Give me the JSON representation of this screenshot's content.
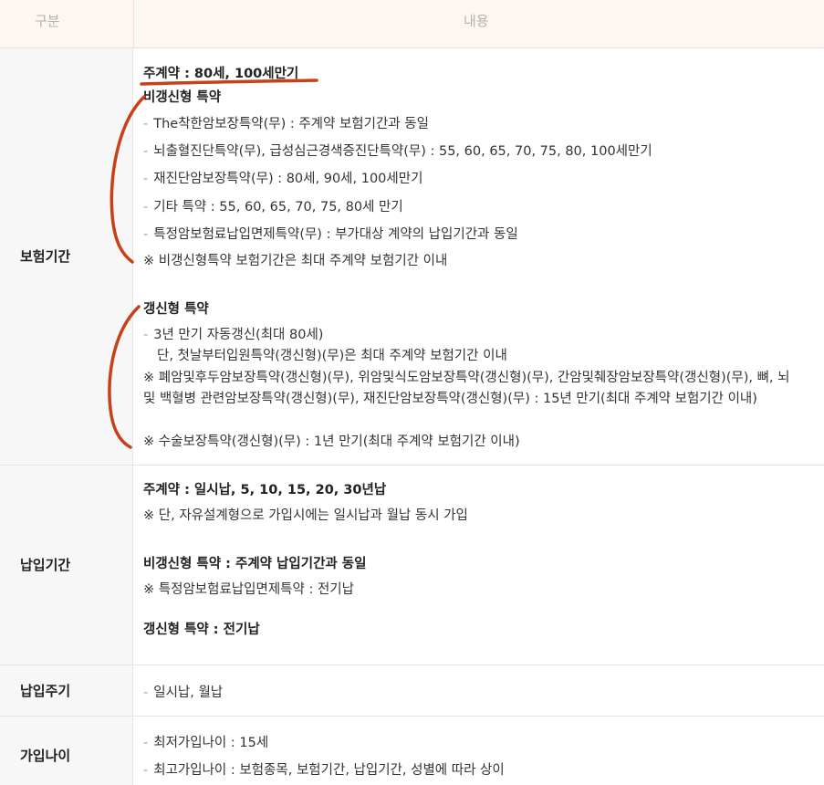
{
  "header": {
    "col1": "구분",
    "col2": "내용"
  },
  "rows": {
    "period": {
      "label": "보험기간",
      "main": "주계약 : 80세, 100세만기",
      "nonrenew_title": "비갱신형 특약",
      "nonrenew_items": [
        "The착한암보장특약(무) : 주계약 보험기간과 동일",
        "뇌출혈진단특약(무), 급성심근경색증진단특약(무) : 55, 60, 65, 70, 75, 80, 100세만기",
        "재진단암보장특약(무) : 80세, 90세, 100세만기",
        "기타 특약 : 55, 60, 65, 70, 75, 80세 만기",
        "특정암보험료납입면제특약(무) : 부가대상 계약의 납입기간과 동일"
      ],
      "nonrenew_note": "※ 비갱신형특약 보험기간은 최대 주계약 보험기간 이내",
      "renew_title": "갱신형 특약",
      "renew_item1": "3년 만기 자동갱신(최대 80세)",
      "renew_item1_sub": "단, 첫날부터입원특약(갱신형)(무)은 최대 주계약 보험기간 이내",
      "renew_note1": "※ 폐암및후두암보장특약(갱신형)(무), 위암및식도암보장특약(갱신형)(무), 간암및췌장암보장특약(갱신형)(무), 뼈, 뇌 및 백혈병 관련암보장특약(갱신형)(무), 재진단암보장특약(갱신형)(무) : 15년 만기(최대 주계약 보험기간 이내)",
      "renew_note2": "※ 수술보장특약(갱신형)(무) : 1년 만기(최대 주계약 보험기간 이내)"
    },
    "payment": {
      "label": "납입기간",
      "main": "주계약 : 일시납, 5, 10, 15, 20, 30년납",
      "main_note": "※ 단, 자유설계형으로 가입시에는 일시납과 월납 동시 가입",
      "nonrenew": "비갱신형 특약 : 주계약 납입기간과 동일",
      "nonrenew_note": "※ 특정암보험료납입면제특약 : 전기납",
      "renew": "갱신형 특약 : 전기납"
    },
    "cycle": {
      "label": "납입주기",
      "item": "일시납, 월납"
    },
    "age": {
      "label": "가입나이",
      "items": [
        "최저가입나이 : 15세",
        "최고가입나이 : 보험종목, 보험기간, 납입기간, 성별에 따라 상이"
      ]
    }
  },
  "colors": {
    "accent_dash": "#e8884a",
    "annotation_red": "#c8401a",
    "label_bg": "#f7f7f7",
    "header_bg": "#fdf7f3"
  }
}
